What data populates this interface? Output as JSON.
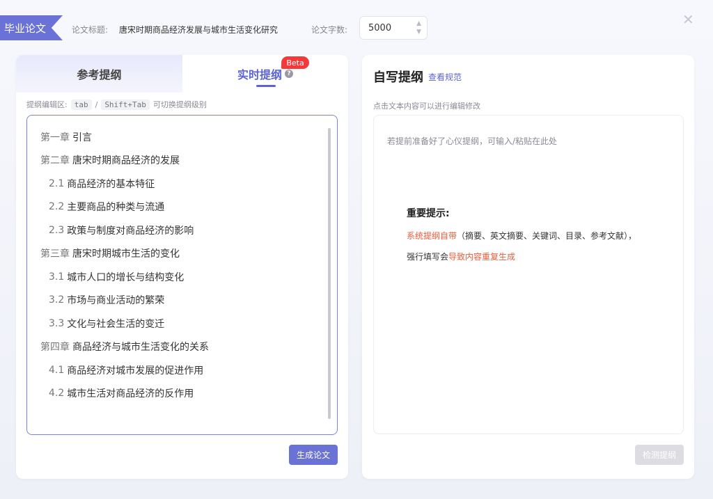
{
  "header": {
    "tag": "毕业论文",
    "title_label": "论文标题:",
    "title_value": "唐宋时期商品经济发展与城市生活变化研究",
    "count_label": "论文字数:",
    "count_value": "5000",
    "close": "✕"
  },
  "left": {
    "tab_reference": "参考提纲",
    "tab_live": "实时提纲",
    "beta": "Beta",
    "hint_prefix": "提纲编辑区:",
    "key_tab": "tab",
    "key_sep": "/",
    "key_shift_tab": "Shift+Tab",
    "hint_suffix": "可切换提纲级别",
    "outline": [
      {
        "num": "第一章",
        "text": "引言"
      },
      {
        "num": "第二章",
        "text": "唐宋时期商品经济的发展"
      },
      {
        "num": "2.1",
        "text": "商品经济的基本特征"
      },
      {
        "num": "2.2",
        "text": "主要商品的种类与流通"
      },
      {
        "num": "2.3",
        "text": "政策与制度对商品经济的影响"
      },
      {
        "num": "第三章",
        "text": "唐宋时期城市生活的变化"
      },
      {
        "num": "3.1",
        "text": "城市人口的增长与结构变化"
      },
      {
        "num": "3.2",
        "text": "市场与商业活动的繁荣"
      },
      {
        "num": "3.3",
        "text": "文化与社会生活的变迁"
      },
      {
        "num": "第四章",
        "text": "商品经济与城市生活变化的关系"
      },
      {
        "num": "4.1",
        "text": "商品经济对城市发展的促进作用"
      },
      {
        "num": "4.2",
        "text": "城市生活对商品经济的反作用"
      }
    ],
    "generate_button": "生成论文"
  },
  "right": {
    "title": "自写提纲",
    "view_rules": "查看规范",
    "hint": "点击文本内容可以进行编辑修改",
    "placeholder": "若提前准备好了心仪提纲，可输入/粘贴在此处",
    "notice_title": "重要提示:",
    "notice_line1_red": "系统提纲自带",
    "notice_line1_rest": "（摘要、英文摘要、关键词、目录、参考文献），",
    "notice_line2_prefix": "强行填写会",
    "notice_line2_red": "导致内容重复生成",
    "detect_button": "检测提纲"
  },
  "colors": {
    "accent": "#5d64d2",
    "warning": "#f05a3a",
    "beta": "#f23a3a"
  }
}
